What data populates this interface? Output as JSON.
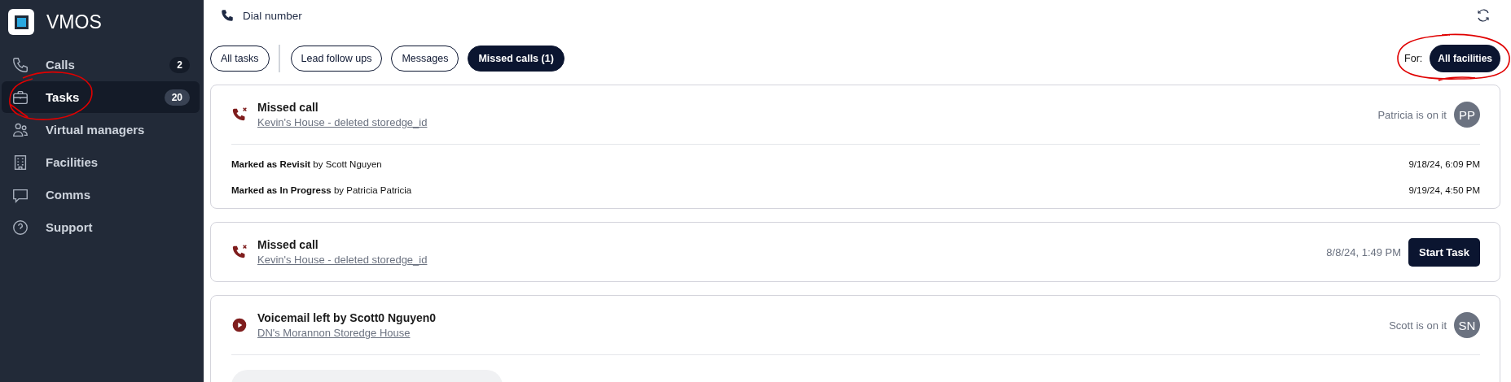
{
  "sidebar": {
    "logo": "VMOS",
    "items": [
      {
        "label": "Calls",
        "badge": "2",
        "selected": false
      },
      {
        "label": "Tasks",
        "badge": "20",
        "selected": true
      },
      {
        "label": "Virtual managers",
        "selected": false
      },
      {
        "label": "Facilities",
        "selected": false
      },
      {
        "label": "Comms",
        "selected": false
      },
      {
        "label": "Support",
        "selected": false
      }
    ]
  },
  "header": {
    "dial_label": "Dial number"
  },
  "tabs": [
    {
      "label": "All tasks",
      "selected": false
    },
    {
      "label": "Lead follow ups",
      "selected": false
    },
    {
      "label": "Messages",
      "selected": false
    },
    {
      "label": "Missed calls (1)",
      "selected": true
    }
  ],
  "filter": {
    "label": "For:",
    "value": "All facilities"
  },
  "cards": [
    {
      "kind": "missed_call",
      "title": "Missed call",
      "link": "Kevin's House - deleted storedge_id",
      "assignee": {
        "text": "Patricia is on it",
        "initials": "PP"
      },
      "history": [
        {
          "text": "**Marked as Revisit** by Scott Nguyen",
          "time": "9/18/24, 6:09 PM"
        },
        {
          "text": "**Marked as In Progress** by Patricia Patricia",
          "time": "9/19/24, 4:50 PM"
        }
      ]
    },
    {
      "kind": "missed_call",
      "title": "Missed call",
      "link": "Kevin's House - deleted storedge_id",
      "time": "8/8/24, 1:49 PM",
      "button": "Start Task"
    },
    {
      "kind": "voicemail",
      "title": "Voicemail left by Scott0 Nguyen0",
      "link": "DN's Morannon Storedge House",
      "assignee": {
        "text": "Scott is on it",
        "initials": "SN"
      },
      "player": true
    }
  ]
}
